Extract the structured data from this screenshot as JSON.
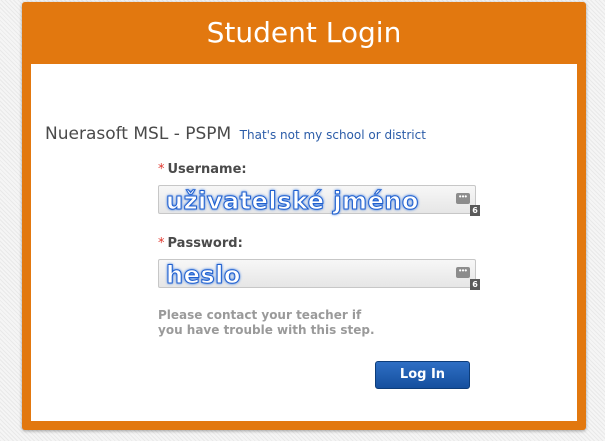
{
  "header": {
    "title": "Student Login"
  },
  "school": {
    "name": "Nuerasoft MSL - PSPM",
    "change_link": "That's not my school or district"
  },
  "form": {
    "username": {
      "required_mark": "*",
      "label": "Username:",
      "value": "uživatelské jméno",
      "badge": "6"
    },
    "password": {
      "required_mark": "*",
      "label": "Password:",
      "value": "heslo",
      "badge": "6"
    },
    "help_text_line1": "Please contact your teacher if",
    "help_text_line2": "you have trouble with this step.",
    "submit_label": "Log In"
  },
  "colors": {
    "accent": "#e2780f",
    "button": "#1a5bb0",
    "required": "#e0362c",
    "link": "#2b5ca8"
  }
}
